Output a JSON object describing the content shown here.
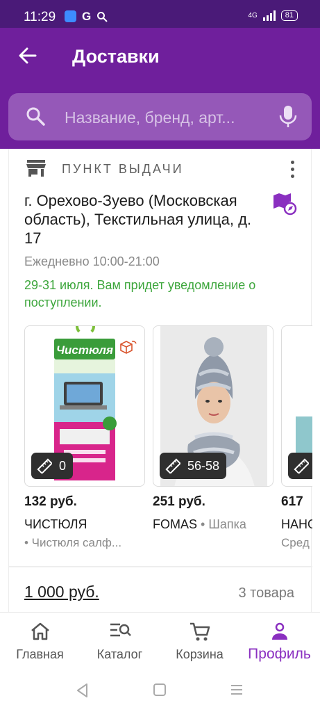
{
  "status": {
    "time": "11:29",
    "network": "4G",
    "battery": "81"
  },
  "header": {
    "title": "Доставки"
  },
  "search": {
    "placeholder": "Название, бренд, арт..."
  },
  "pickup": {
    "label": "ПУНКТ ВЫДАЧИ",
    "address": "г. Орехово-Зуево (Московская область), Текстильная улица, д. 17",
    "hours": "Ежедневно 10:00-21:00",
    "notice": "29-31 июля. Вам придет уведомление о поступлении."
  },
  "products": [
    {
      "size": "0",
      "price": "132 руб.",
      "brand": "ЧИСТЮЛЯ",
      "category": "",
      "description": "• Чистюля салф..."
    },
    {
      "size": "56-58",
      "price": "251 руб.",
      "brand": "FOMAS",
      "category": " • Шапка",
      "description": ""
    },
    {
      "size": "",
      "price": "617",
      "brand": "НАНО",
      "category": "",
      "description": "Сред"
    }
  ],
  "summary": {
    "total": "1 000 руб.",
    "count": "3 товара"
  },
  "nav": {
    "home": "Главная",
    "catalog": "Каталог",
    "cart": "Корзина",
    "profile": "Профиль"
  },
  "colors": {
    "header": "#6f1f9c",
    "accent": "#8a2fc0",
    "green": "#3da63c"
  }
}
